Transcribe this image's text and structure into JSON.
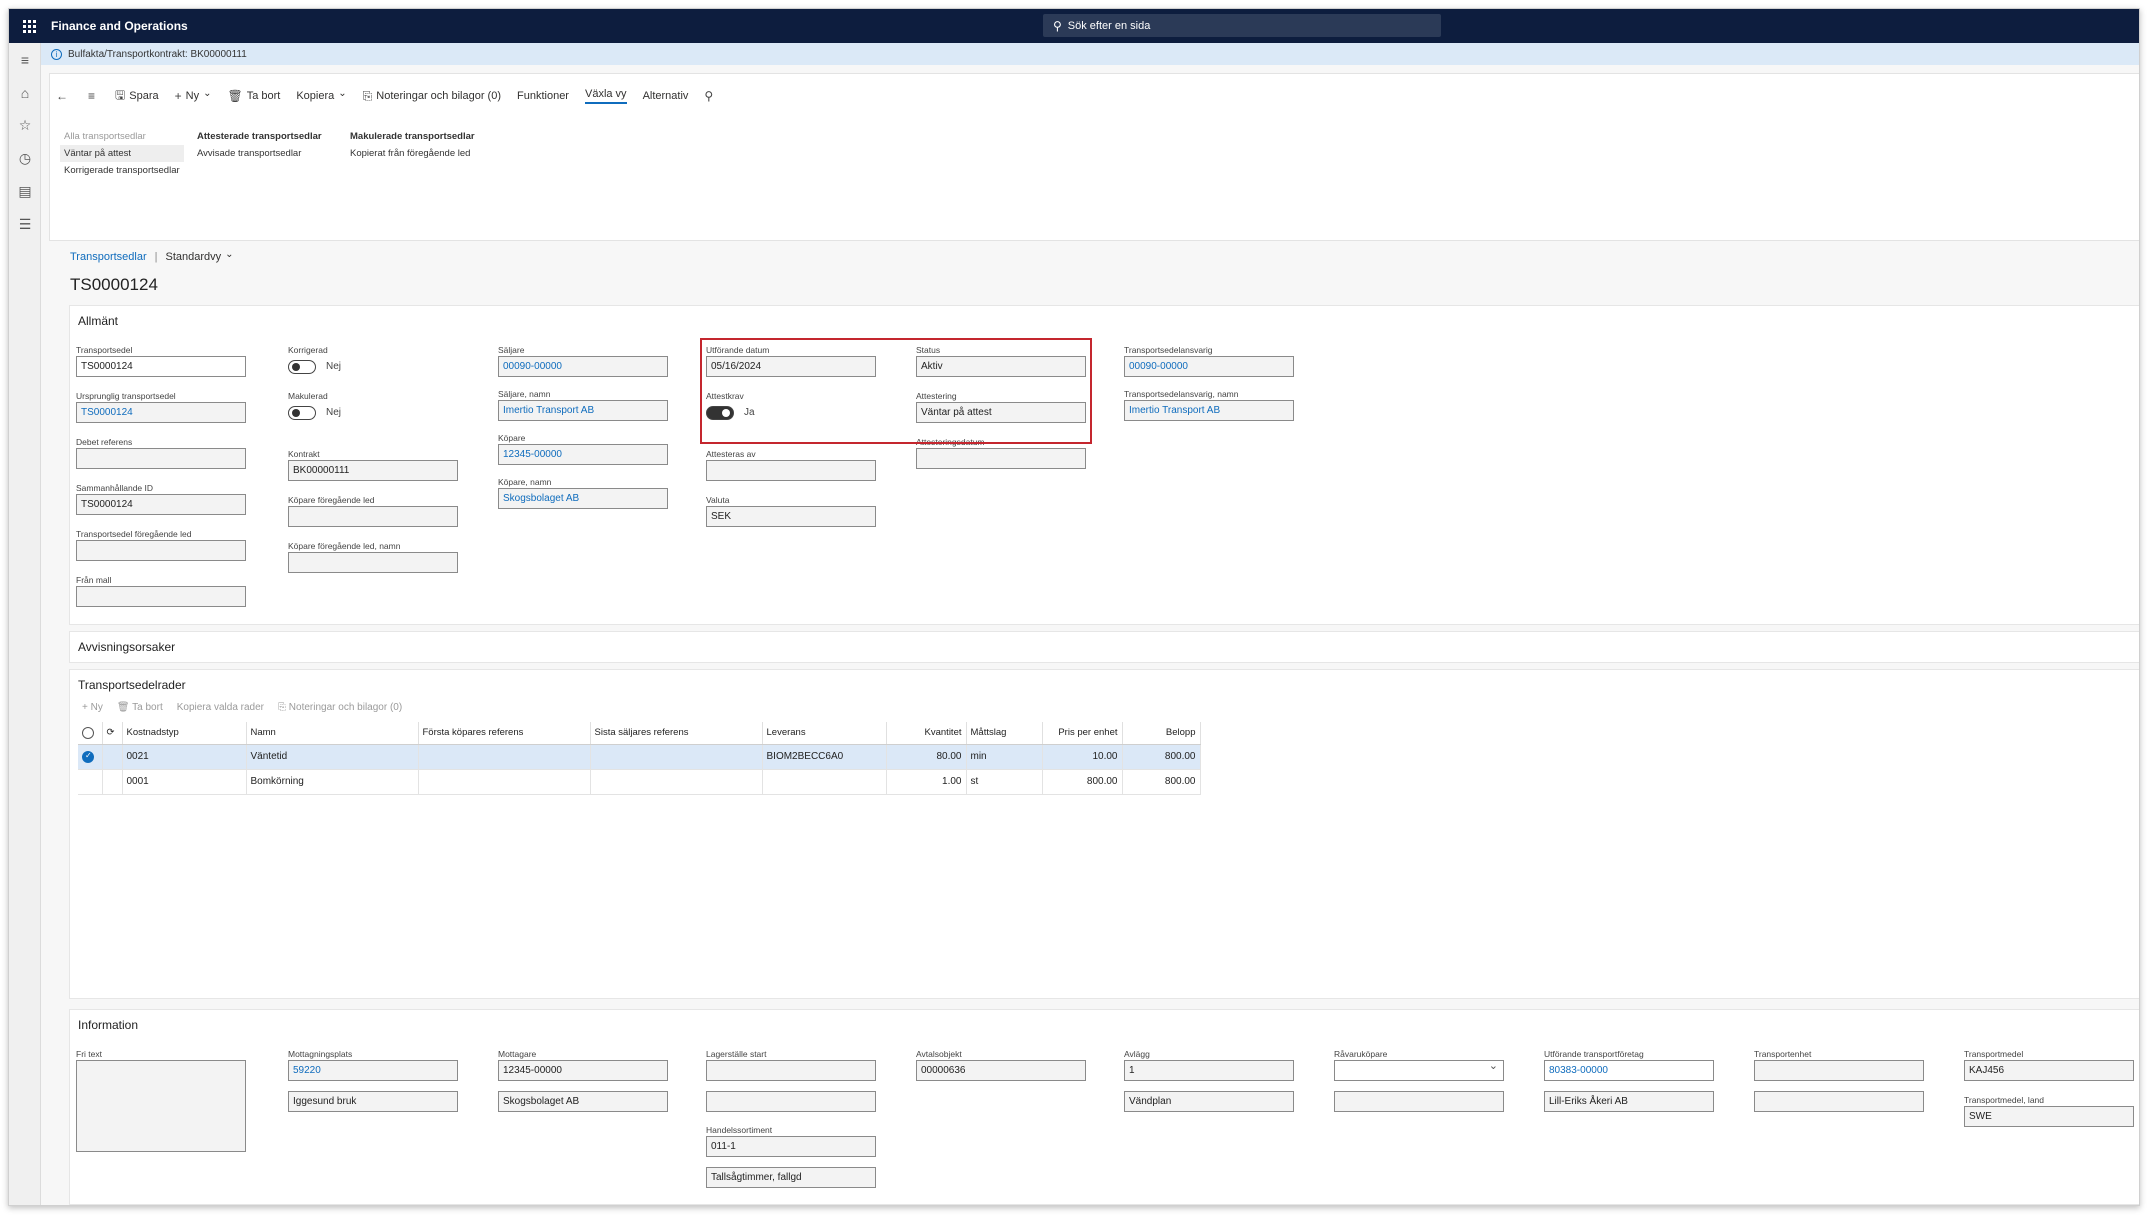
{
  "app": {
    "title": "Finance and Operations",
    "search_placeholder": "Sök efter en sida"
  },
  "crumb": {
    "path": "Bulfakta/Transportkontrakt: BK00000111"
  },
  "toolbar": {
    "save": "Spara",
    "new": "Ny",
    "delete": "Ta bort",
    "copy": "Kopiera",
    "notes": "Noteringar och bilagor (0)",
    "functions": "Funktioner",
    "switch_view": "Växla vy",
    "options": "Alternativ"
  },
  "submenu": {
    "col1": [
      "Alla transportsedlar",
      "Väntar på attest",
      "Korrigerade transportsedlar"
    ],
    "col2": [
      "Attesterade transportsedlar",
      "Avvisade transportsedlar"
    ],
    "col3": [
      "Makulerade transportsedlar",
      "Kopierat från föregående led"
    ]
  },
  "nav": {
    "link": "Transportsedlar",
    "view": "Standardvy"
  },
  "page_title": "TS0000124",
  "general": {
    "title": "Allmänt",
    "transportsedel_lbl": "Transportsedel",
    "transportsedel": "TS0000124",
    "ursprunglig_lbl": "Ursprunglig transportsedel",
    "ursprunglig": "TS0000124",
    "debet_lbl": "Debet referens",
    "debet": "",
    "samman_lbl": "Sammanhållande ID",
    "samman": "TS0000124",
    "foreg_lbl": "Transportsedel föregående led",
    "foreg": "",
    "mall_lbl": "Från mall",
    "mall": "",
    "korrigerad_lbl": "Korrigerad",
    "korrigerad": "Nej",
    "makulerad_lbl": "Makulerad",
    "makulerad": "Nej",
    "kontrakt_lbl": "Kontrakt",
    "kontrakt": "BK00000111",
    "kopare_foreg_lbl": "Köpare föregående led",
    "kopare_foreg": "",
    "kopare_foreg_namn_lbl": "Köpare föregående led, namn",
    "kopare_foreg_namn": "",
    "saljare_lbl": "Säljare",
    "saljare": "00090-00000",
    "saljare_namn_lbl": "Säljare, namn",
    "saljare_namn": "Imertio Transport AB",
    "kopare_lbl": "Köpare",
    "kopare": "12345-00000",
    "kopare_namn_lbl": "Köpare, namn",
    "kopare_namn": "Skogsbolaget AB",
    "utf_datum_lbl": "Utförande datum",
    "utf_datum": "05/16/2024",
    "attestkrav_lbl": "Attestkrav",
    "attestkrav": "Ja",
    "attesteras_av_lbl": "Attesteras av",
    "attesteras_av": "",
    "valuta_lbl": "Valuta",
    "valuta": "SEK",
    "status_lbl": "Status",
    "status": "Aktiv",
    "attestering_lbl": "Attestering",
    "attestering": "Väntar på attest",
    "attest_datum_lbl": "Attesteringsdatum",
    "attest_datum": "",
    "ansvarig_lbl": "Transportsedelansvarig",
    "ansvarig": "00090-00000",
    "ansvarig_namn_lbl": "Transportsedelansvarig, namn",
    "ansvarig_namn": "Imertio Transport AB"
  },
  "reject": {
    "title": "Avvisningsorsaker"
  },
  "lines": {
    "title": "Transportsedelrader",
    "toolbar": [
      "Ny",
      "Ta bort",
      "Kopiera valda rader",
      "Noteringar och bilagor (0)"
    ],
    "headers": [
      "Kostnadstyp",
      "Namn",
      "Första köpares referens",
      "Sista säljares referens",
      "Leverans",
      "Kvantitet",
      "Måttslag",
      "Pris per enhet",
      "Belopp"
    ],
    "rows": [
      {
        "kostnadstyp": "0021",
        "namn": "Väntetid",
        "forsta": "",
        "sista": "",
        "leverans": "BIOM2BECC6A0",
        "kvantitet": "80.00",
        "mattslag": "min",
        "pris": "10.00",
        "belopp": "800.00",
        "selected": true
      },
      {
        "kostnadstyp": "0001",
        "namn": "Bomkörning",
        "forsta": "",
        "sista": "",
        "leverans": "",
        "kvantitet": "1.00",
        "mattslag": "st",
        "pris": "800.00",
        "belopp": "800.00",
        "selected": false
      }
    ]
  },
  "info": {
    "title": "Information",
    "fritext_lbl": "Fri text",
    "fritext": "",
    "mottagningsplats_lbl": "Mottagningsplats",
    "mottagningsplats": "59220",
    "mottagningsplats_namn": "Iggesund bruk",
    "mottagare_lbl": "Mottagare",
    "mottagare": "12345-00000",
    "mottagare_namn": "Skogsbolaget AB",
    "lagerstalle_lbl": "Lagerställe start",
    "lagerstalle": "",
    "lagerstalle2": "",
    "handelssortiment_lbl": "Handelssortiment",
    "handelssortiment": "011-1",
    "handelssortiment_namn": "Tallsågtimmer, fallgd",
    "avtalsobjekt_lbl": "Avtalsobjekt",
    "avtalsobjekt": "00000636",
    "avlagg_lbl": "Avlägg",
    "avlagg": "1",
    "avlagg_namn": "Vändplan",
    "ravaruk_lbl": "Råvaruköpare",
    "ravaruk": "",
    "ravaruk2": "",
    "utf_foretag_lbl": "Utförande transportföretag",
    "utf_foretag": "80383-00000",
    "utf_foretag_namn": "Lill-Eriks Åkeri AB",
    "transportenhet_lbl": "Transportenhet",
    "transportenhet": "",
    "transportenhet2": "",
    "transportmedel_lbl": "Transportmedel",
    "transportmedel": "KAJ456",
    "transportmedel_land_lbl": "Transportmedel, land",
    "transportmedel_land": "SWE"
  }
}
